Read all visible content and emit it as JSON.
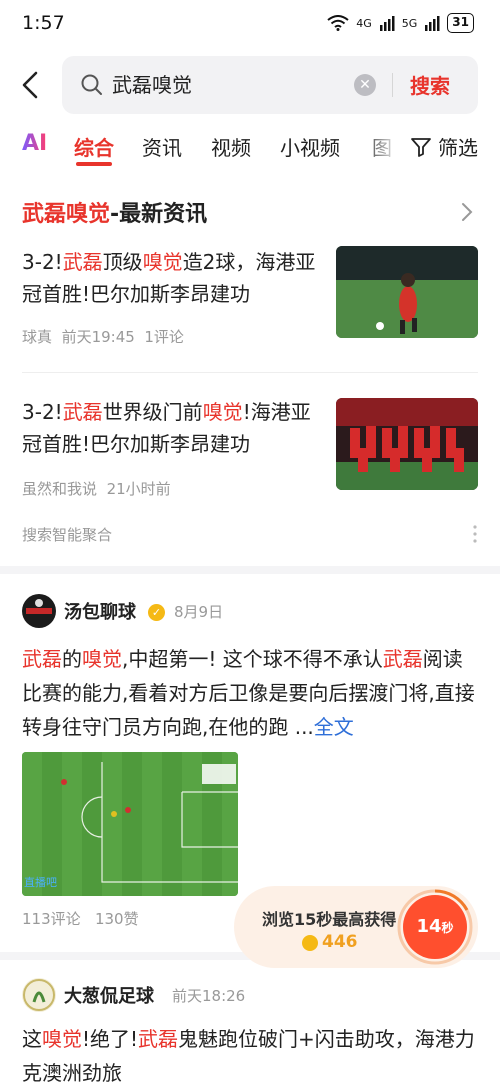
{
  "status_bar": {
    "time": "1:57",
    "net1": "4G",
    "net2": "5G",
    "battery": "31"
  },
  "search": {
    "query": "武磊嗅觉",
    "button_label": "搜索"
  },
  "tabs": {
    "ai": "AI",
    "items": [
      "综合",
      "资讯",
      "视频",
      "小视频",
      "图"
    ],
    "filter_label": "筛选"
  },
  "section": {
    "keyword": "武磊嗅觉",
    "suffix": "-最新资讯"
  },
  "news": [
    {
      "title_parts": [
        "3-2!",
        "武磊",
        "顶级",
        "嗅觉",
        "造2球，海港亚冠首胜!巴尔加斯李昂建功"
      ],
      "source": "球真",
      "time": "前天19:45",
      "comments": "1评论"
    },
    {
      "title_parts": [
        "3-2!",
        "武磊",
        "世界级门前",
        "嗅觉",
        "!海港亚冠首胜!巴尔加斯李昂建功"
      ],
      "source": "虽然和我说",
      "time": "21小时前"
    }
  ],
  "smart_aggregate": "搜索智能聚合",
  "post1": {
    "author": "汤包聊球",
    "date": "8月9日",
    "body_parts": [
      "武磊",
      "的",
      "嗅觉",
      ",中超第一! 这个球不得不承认",
      "武磊",
      "阅读比赛的能力,看着对方后卫像是要向后摆渡门将,直接转身往守门员方向跑,在他的跑 ..."
    ],
    "full_text": "全文",
    "comments": "113评论",
    "likes": "130赞"
  },
  "reward": {
    "title": "浏览15秒最高获得",
    "coins": "446",
    "seconds": "14",
    "unit": "秒"
  },
  "post2": {
    "author": "大葱侃足球",
    "date": "前天18:26",
    "body_parts": [
      "这",
      "嗅觉",
      "!绝了!",
      "武磊",
      "鬼魅跑位破门+闪击助攻，海港力克澳洲劲旅"
    ]
  },
  "colors": {
    "accent": "#e8342c",
    "link": "#2f6fd8",
    "meta": "#999999"
  }
}
